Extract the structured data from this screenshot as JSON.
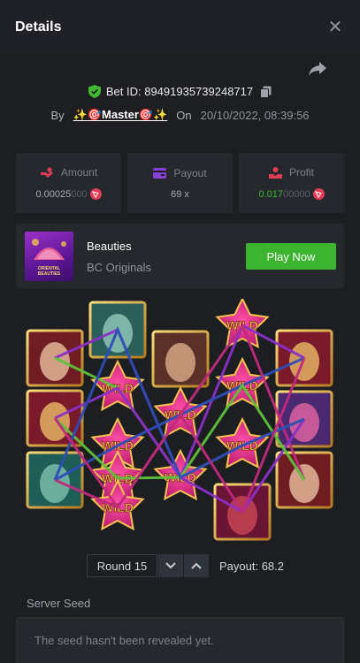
{
  "header": {
    "title": "Details",
    "close_icon": "close-icon"
  },
  "bet": {
    "id_label": "Bet ID: 89491935739248717",
    "by_label": "By",
    "user": "✨🎯Master🎯✨",
    "on_label": "On",
    "date": "20/10/2022, 08:39:56"
  },
  "stats": {
    "amount": {
      "label": "Amount",
      "value_main": "0.00025",
      "value_dim": "000"
    },
    "payout": {
      "label": "Payout",
      "value": "69 x"
    },
    "profit": {
      "label": "Profit",
      "value_main": "0.017",
      "value_dim": "00000"
    }
  },
  "game": {
    "name": "Beauties",
    "provider": "BC Originals",
    "play_label": "Play Now",
    "thumb_text_1": "ORIENTAL",
    "thumb_text_2": "BEAUTIES"
  },
  "round": {
    "label": "Round 15",
    "payout": "Payout: 68.2"
  },
  "seed": {
    "title": "Server Seed",
    "text": "The seed hasn't been revealed yet."
  },
  "board": {
    "wild_text": "WILD",
    "columns": [
      [
        "woman-a",
        "comb",
        "fan"
      ],
      [
        "fan-top",
        "wild",
        "wild",
        "wild",
        "wild"
      ],
      [
        "woman-b",
        "wild",
        "wild"
      ],
      [
        "wild",
        "wild",
        "wild",
        "drum"
      ],
      [
        "comb",
        "flower",
        "woman-a"
      ]
    ]
  },
  "colors": {
    "accent_green": "#3db42f",
    "line_purple": "#8b2fc9",
    "line_green": "#5cc23a",
    "line_blue": "#2d4db8",
    "line_pink": "#c02a7e"
  }
}
